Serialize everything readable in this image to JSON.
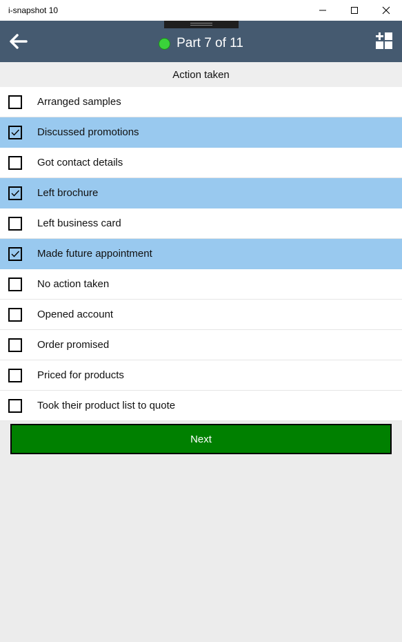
{
  "window": {
    "title": "i-snapshot 10",
    "controls": [
      "minimize-icon",
      "maximize-icon",
      "close-icon"
    ]
  },
  "header": {
    "back_icon": "arrow-left-icon",
    "part_label": "Part 7 of 11",
    "status_color": "#3ad33a",
    "menu_icon": "grid-plus-icon",
    "background": "#455a70"
  },
  "section": {
    "title": "Action taken"
  },
  "options": [
    {
      "label": "Arranged samples",
      "checked": false
    },
    {
      "label": "Discussed promotions",
      "checked": true
    },
    {
      "label": "Got contact details",
      "checked": false
    },
    {
      "label": "Left brochure",
      "checked": true
    },
    {
      "label": "Left business card",
      "checked": false
    },
    {
      "label": "Made future appointment",
      "checked": true
    },
    {
      "label": "No action taken",
      "checked": false
    },
    {
      "label": "Opened account",
      "checked": false
    },
    {
      "label": "Order promised",
      "checked": false
    },
    {
      "label": "Priced for products",
      "checked": false
    },
    {
      "label": "Took their product list to quote",
      "checked": false
    }
  ],
  "next_button": {
    "label": "Next",
    "color": "#008000"
  },
  "colors": {
    "selected_row": "#99c9ef"
  }
}
